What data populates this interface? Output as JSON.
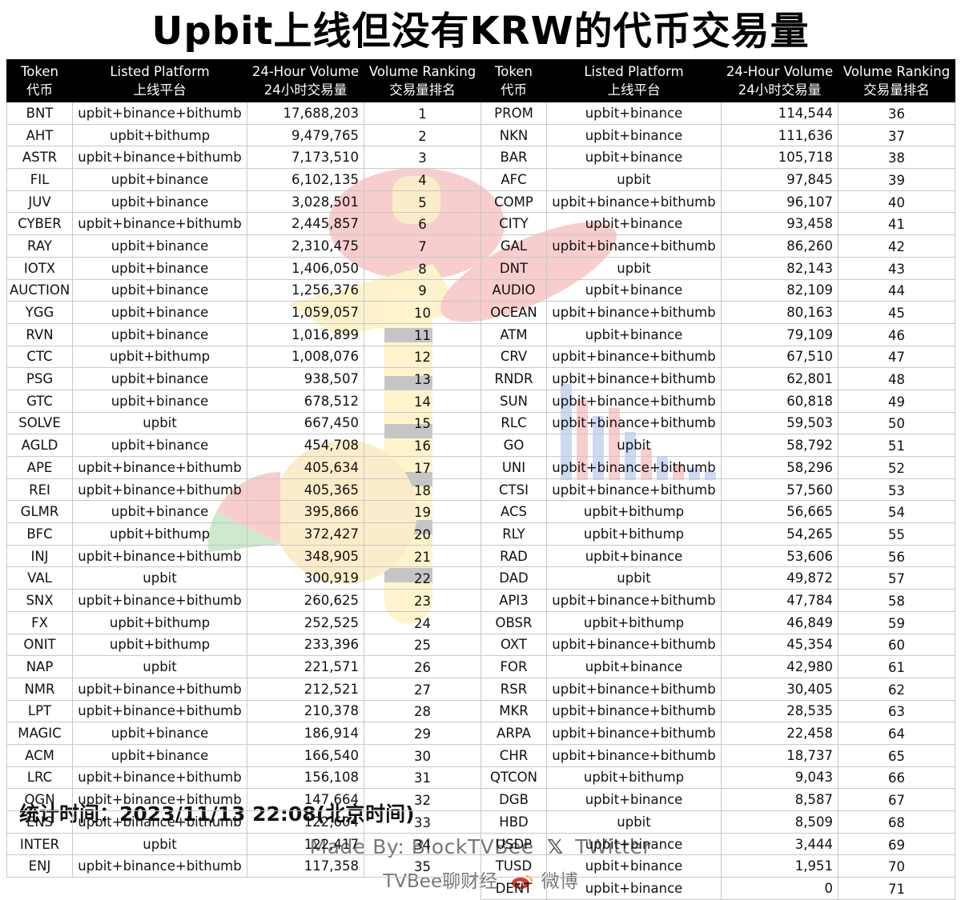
{
  "title": "Upbit上线但没有KRW的代币交易量",
  "headers": {
    "token": [
      "Token",
      "代币"
    ],
    "platform": [
      "Listed Platform",
      "上线平台"
    ],
    "volume": [
      "24-Hour Volume",
      "24小时交易量"
    ],
    "ranking": [
      "Volume Ranking",
      "交易量排名"
    ]
  },
  "rows": [
    {
      "token": "BNT",
      "platform": "upbit+binance+bithumb",
      "volume": "17,688,203",
      "rank": "1"
    },
    {
      "token": "AHT",
      "platform": "upbit+bithump",
      "volume": "9,479,765",
      "rank": "2"
    },
    {
      "token": "ASTR",
      "platform": "upbit+binance+bithumb",
      "volume": "7,173,510",
      "rank": "3"
    },
    {
      "token": "FIL",
      "platform": "upbit+binance",
      "volume": "6,102,135",
      "rank": "4"
    },
    {
      "token": "JUV",
      "platform": "upbit+binance",
      "volume": "3,028,501",
      "rank": "5"
    },
    {
      "token": "CYBER",
      "platform": "upbit+binance+bithumb",
      "volume": "2,445,857",
      "rank": "6"
    },
    {
      "token": "RAY",
      "platform": "upbit+binance",
      "volume": "2,310,475",
      "rank": "7"
    },
    {
      "token": "IOTX",
      "platform": "upbit+binance",
      "volume": "1,406,050",
      "rank": "8"
    },
    {
      "token": "AUCTION",
      "platform": "upbit+binance",
      "volume": "1,256,376",
      "rank": "9"
    },
    {
      "token": "YGG",
      "platform": "upbit+binance",
      "volume": "1,059,057",
      "rank": "10"
    },
    {
      "token": "RVN",
      "platform": "upbit+binance",
      "volume": "1,016,899",
      "rank": "11"
    },
    {
      "token": "CTC",
      "platform": "upbit+bithump",
      "volume": "1,008,076",
      "rank": "12"
    },
    {
      "token": "PSG",
      "platform": "upbit+binance",
      "volume": "938,507",
      "rank": "13"
    },
    {
      "token": "GTC",
      "platform": "upbit+binance",
      "volume": "678,512",
      "rank": "14"
    },
    {
      "token": "SOLVE",
      "platform": "upbit",
      "volume": "667,450",
      "rank": "15"
    },
    {
      "token": "AGLD",
      "platform": "upbit+binance",
      "volume": "454,708",
      "rank": "16"
    },
    {
      "token": "APE",
      "platform": "upbit+binance+bithumb",
      "volume": "405,634",
      "rank": "17"
    },
    {
      "token": "REI",
      "platform": "upbit+binance+bithumb",
      "volume": "405,365",
      "rank": "18"
    },
    {
      "token": "GLMR",
      "platform": "upbit+binance",
      "volume": "395,866",
      "rank": "19"
    },
    {
      "token": "BFC",
      "platform": "upbit+bithump",
      "volume": "372,427",
      "rank": "20"
    },
    {
      "token": "INJ",
      "platform": "upbit+binance+bithumb",
      "volume": "348,905",
      "rank": "21"
    },
    {
      "token": "VAL",
      "platform": "upbit",
      "volume": "300,919",
      "rank": "22"
    },
    {
      "token": "SNX",
      "platform": "upbit+binance+bithumb",
      "volume": "260,625",
      "rank": "23"
    },
    {
      "token": "FX",
      "platform": "upbit+bithump",
      "volume": "252,525",
      "rank": "24"
    },
    {
      "token": "ONIT",
      "platform": "upbit+bithump",
      "volume": "233,396",
      "rank": "25"
    },
    {
      "token": "NAP",
      "platform": "upbit",
      "volume": "221,571",
      "rank": "26"
    },
    {
      "token": "NMR",
      "platform": "upbit+binance+bithumb",
      "volume": "212,521",
      "rank": "27"
    },
    {
      "token": "LPT",
      "platform": "upbit+binance+bithumb",
      "volume": "210,378",
      "rank": "28"
    },
    {
      "token": "MAGIC",
      "platform": "upbit+binance",
      "volume": "186,914",
      "rank": "29"
    },
    {
      "token": "ACM",
      "platform": "upbit+binance",
      "volume": "166,540",
      "rank": "30"
    },
    {
      "token": "LRC",
      "platform": "upbit+binance+bithumb",
      "volume": "156,108",
      "rank": "31"
    },
    {
      "token": "OGN",
      "platform": "upbit+binance+bithumb",
      "volume": "147,664",
      "rank": "32"
    },
    {
      "token": "ENS",
      "platform": "upbit+binance+bithumb",
      "volume": "122,604",
      "rank": "33"
    },
    {
      "token": "INTER",
      "platform": "upbit",
      "volume": "122,417",
      "rank": "34"
    },
    {
      "token": "ENJ",
      "platform": "upbit+binance+bithumb",
      "volume": "117,358",
      "rank": "35"
    },
    {
      "token": "PROM",
      "platform": "upbit+binance",
      "volume": "114,544",
      "rank": "36"
    },
    {
      "token": "NKN",
      "platform": "upbit+binance",
      "volume": "111,636",
      "rank": "37"
    },
    {
      "token": "BAR",
      "platform": "upbit+binance",
      "volume": "105,718",
      "rank": "38"
    },
    {
      "token": "AFC",
      "platform": "upbit",
      "volume": "97,845",
      "rank": "39"
    },
    {
      "token": "COMP",
      "platform": "upbit+binance+bithumb",
      "volume": "96,107",
      "rank": "40"
    },
    {
      "token": "CITY",
      "platform": "upbit+binance",
      "volume": "93,458",
      "rank": "41"
    },
    {
      "token": "GAL",
      "platform": "upbit+binance+bithumb",
      "volume": "86,260",
      "rank": "42"
    },
    {
      "token": "DNT",
      "platform": "upbit",
      "volume": "82,143",
      "rank": "43"
    },
    {
      "token": "AUDIO",
      "platform": "upbit+binance",
      "volume": "82,109",
      "rank": "44"
    },
    {
      "token": "OCEAN",
      "platform": "upbit+binance+bithumb",
      "volume": "80,163",
      "rank": "45"
    },
    {
      "token": "ATM",
      "platform": "upbit+binance",
      "volume": "79,109",
      "rank": "46"
    },
    {
      "token": "CRV",
      "platform": "upbit+binance+bithumb",
      "volume": "67,510",
      "rank": "47"
    },
    {
      "token": "RNDR",
      "platform": "upbit+binance+bithumb",
      "volume": "62,801",
      "rank": "48"
    },
    {
      "token": "SUN",
      "platform": "upbit+binance+bithumb",
      "volume": "60,818",
      "rank": "49"
    },
    {
      "token": "RLC",
      "platform": "upbit+binance+bithumb",
      "volume": "59,503",
      "rank": "50"
    },
    {
      "token": "GO",
      "platform": "upbit",
      "volume": "58,792",
      "rank": "51"
    },
    {
      "token": "UNI",
      "platform": "upbit+binance+bithumb",
      "volume": "58,296",
      "rank": "52"
    },
    {
      "token": "CTSI",
      "platform": "upbit+binance+bithumb",
      "volume": "57,560",
      "rank": "53"
    },
    {
      "token": "ACS",
      "platform": "upbit+bithump",
      "volume": "56,665",
      "rank": "54"
    },
    {
      "token": "RLY",
      "platform": "upbit+bithump",
      "volume": "54,265",
      "rank": "55"
    },
    {
      "token": "RAD",
      "platform": "upbit+binance",
      "volume": "53,606",
      "rank": "56"
    },
    {
      "token": "DAD",
      "platform": "upbit",
      "volume": "49,872",
      "rank": "57"
    },
    {
      "token": "API3",
      "platform": "upbit+binance+bithumb",
      "volume": "47,784",
      "rank": "58"
    },
    {
      "token": "OBSR",
      "platform": "upbit+bithump",
      "volume": "46,849",
      "rank": "59"
    },
    {
      "token": "OXT",
      "platform": "upbit+binance+bithumb",
      "volume": "45,354",
      "rank": "60"
    },
    {
      "token": "FOR",
      "platform": "upbit+binance",
      "volume": "42,980",
      "rank": "61"
    },
    {
      "token": "RSR",
      "platform": "upbit+binance+bithumb",
      "volume": "30,405",
      "rank": "62"
    },
    {
      "token": "MKR",
      "platform": "upbit+binance+bithumb",
      "volume": "28,535",
      "rank": "63"
    },
    {
      "token": "ARPA",
      "platform": "upbit+binance+bithumb",
      "volume": "22,458",
      "rank": "64"
    },
    {
      "token": "CHR",
      "platform": "upbit+binance+bithumb",
      "volume": "18,737",
      "rank": "65"
    },
    {
      "token": "QTCON",
      "platform": "upbit+bithump",
      "volume": "9,043",
      "rank": "66"
    },
    {
      "token": "DGB",
      "platform": "upbit+binance",
      "volume": "8,587",
      "rank": "67"
    },
    {
      "token": "HBD",
      "platform": "upbit",
      "volume": "8,509",
      "rank": "68"
    },
    {
      "token": "USDP",
      "platform": "upbit+binance",
      "volume": "3,444",
      "rank": "69"
    },
    {
      "token": "TUSD",
      "platform": "upbit+binance",
      "volume": "1,951",
      "rank": "70"
    },
    {
      "token": "DENT",
      "platform": "upbit+binance",
      "volume": "0",
      "rank": "71"
    }
  ],
  "stat_time": "统计时间：2023/11/13 22:08(北京时间)",
  "footer": {
    "made_by": "Made By: BlockTVBee",
    "twitter": "TWitter",
    "brand": "TVBee聊财经",
    "weibo": "微博"
  },
  "icons": {
    "x": "x-logo-icon",
    "weibo": "weibo-logo-icon"
  }
}
